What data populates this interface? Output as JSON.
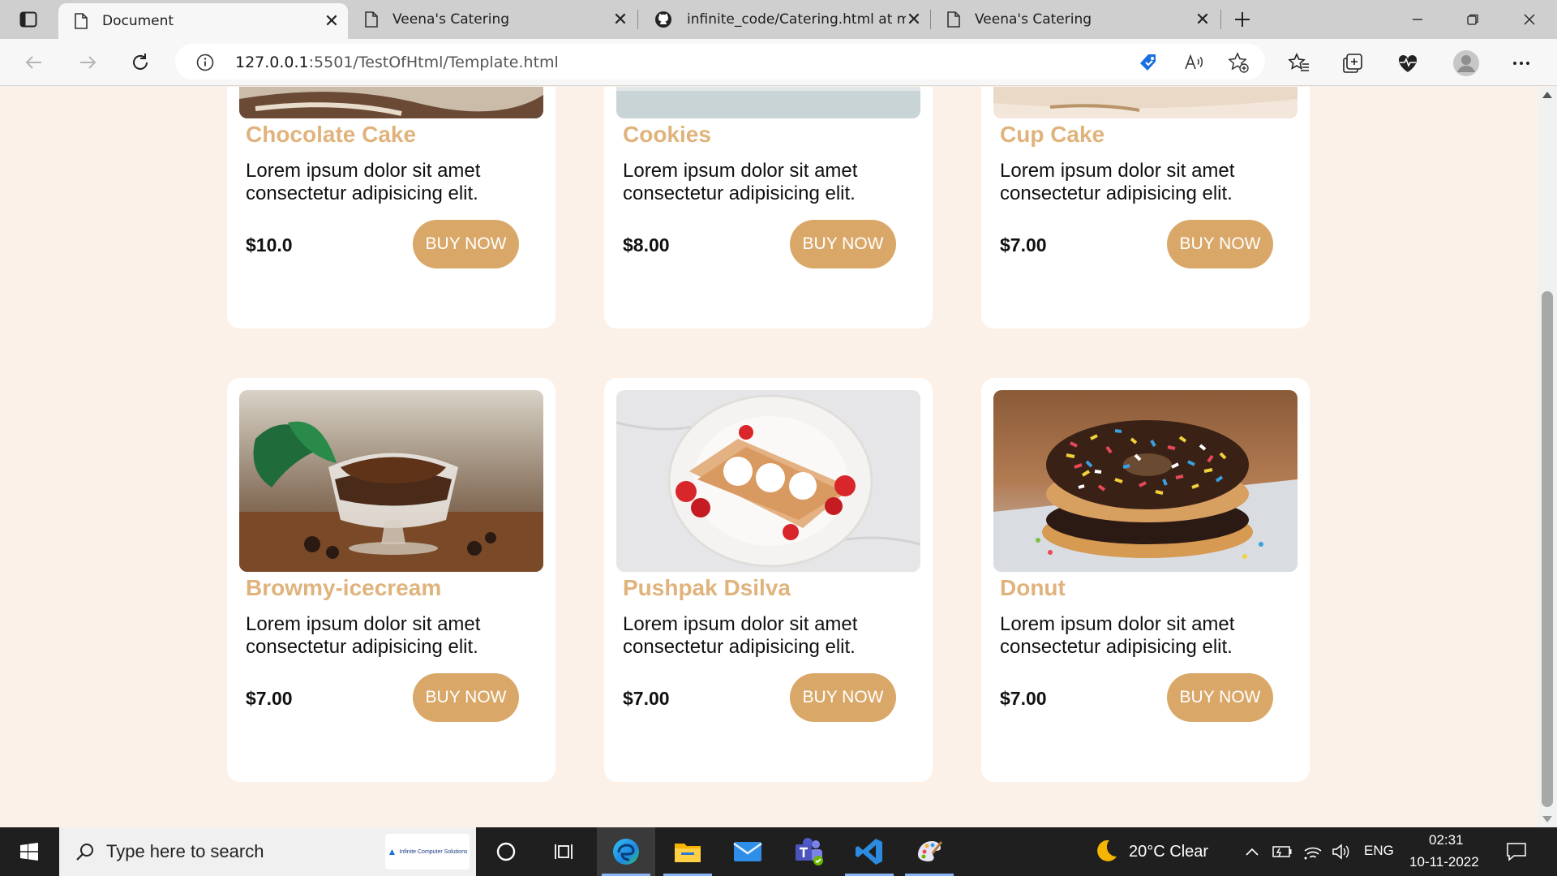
{
  "browser": {
    "tabs": [
      {
        "title": "Document",
        "active": true
      },
      {
        "title": "Veena's Catering",
        "active": false
      },
      {
        "title": "infinite_code/Catering.html at ma",
        "active": false
      },
      {
        "title": "Veena's Catering",
        "active": false
      }
    ],
    "url_host": "127.0.0.1",
    "url_rest": ":5501/TestOfHtml/Template.html"
  },
  "products": [
    {
      "name": "Chocolate Cake",
      "desc": "Lorem ipsum dolor sit amet consectetur adipisicing elit.",
      "price": "$10.0",
      "button": "BUY NOW"
    },
    {
      "name": "Cookies",
      "desc": "Lorem ipsum dolor sit amet consectetur adipisicing elit.",
      "price": "$8.00",
      "button": "BUY NOW"
    },
    {
      "name": "Cup Cake",
      "desc": "Lorem ipsum dolor sit amet consectetur adipisicing elit.",
      "price": "$7.00",
      "button": "BUY NOW"
    },
    {
      "name": "Browmy-icecream",
      "desc": "Lorem ipsum dolor sit amet consectetur adipisicing elit.",
      "price": "$7.00",
      "button": "BUY NOW"
    },
    {
      "name": "Pushpak Dsilva",
      "desc": "Lorem ipsum dolor sit amet consectetur adipisicing elit.",
      "price": "$7.00",
      "button": "BUY NOW"
    },
    {
      "name": "Donut",
      "desc": "Lorem ipsum dolor sit amet consectetur adipisicing elit.",
      "price": "$7.00",
      "button": "BUY NOW"
    }
  ],
  "colors": {
    "accent": "#d9a869",
    "title": "#e0b37c",
    "page_bg": "#fbf1e8"
  },
  "taskbar": {
    "search_placeholder": "Type here to search",
    "promo_text": "Infinite Computer Solutions",
    "weather": "20°C  Clear",
    "language": "ENG",
    "time": "02:31",
    "date": "10-11-2022",
    "pinned": [
      "cortana-icon",
      "task-view-icon",
      "edge-icon",
      "file-explorer-icon",
      "mail-icon",
      "teams-icon",
      "vscode-icon",
      "paint-icon"
    ]
  }
}
